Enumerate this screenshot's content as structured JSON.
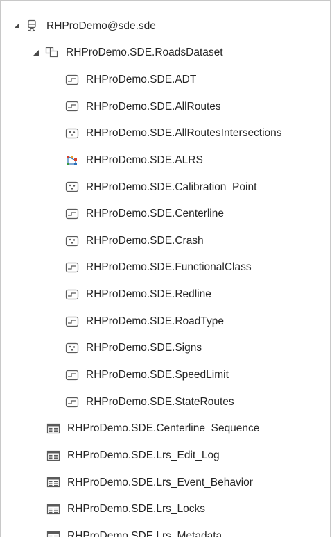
{
  "tree": {
    "root": {
      "label": "RHProDemo@sde.sde",
      "icon": "database-icon",
      "expanded": true
    },
    "dataset": {
      "label": "RHProDemo.SDE.RoadsDataset",
      "icon": "feature-dataset-icon",
      "expanded": true
    },
    "dataset_children": [
      {
        "label": "RHProDemo.SDE.ADT",
        "icon": "line-feature-class-icon"
      },
      {
        "label": "RHProDemo.SDE.AllRoutes",
        "icon": "line-feature-class-icon"
      },
      {
        "label": "RHProDemo.SDE.AllRoutesIntersections",
        "icon": "point-feature-class-icon"
      },
      {
        "label": "RHProDemo.SDE.ALRS",
        "icon": "lrs-network-icon"
      },
      {
        "label": "RHProDemo.SDE.Calibration_Point",
        "icon": "point-feature-class-icon"
      },
      {
        "label": "RHProDemo.SDE.Centerline",
        "icon": "line-feature-class-icon"
      },
      {
        "label": "RHProDemo.SDE.Crash",
        "icon": "point-feature-class-icon"
      },
      {
        "label": "RHProDemo.SDE.FunctionalClass",
        "icon": "line-feature-class-icon"
      },
      {
        "label": "RHProDemo.SDE.Redline",
        "icon": "line-feature-class-icon"
      },
      {
        "label": "RHProDemo.SDE.RoadType",
        "icon": "line-feature-class-icon"
      },
      {
        "label": "RHProDemo.SDE.Signs",
        "icon": "point-feature-class-icon"
      },
      {
        "label": "RHProDemo.SDE.SpeedLimit",
        "icon": "line-feature-class-icon"
      },
      {
        "label": "RHProDemo.SDE.StateRoutes",
        "icon": "line-feature-class-icon"
      }
    ],
    "tables": [
      {
        "label": "RHProDemo.SDE.Centerline_Sequence",
        "icon": "table-icon"
      },
      {
        "label": "RHProDemo.SDE.Lrs_Edit_Log",
        "icon": "table-icon"
      },
      {
        "label": "RHProDemo.SDE.Lrs_Event_Behavior",
        "icon": "table-icon"
      },
      {
        "label": "RHProDemo.SDE.Lrs_Locks",
        "icon": "table-icon"
      },
      {
        "label": "RHProDemo.SDE.Lrs_Metadata",
        "icon": "table-icon"
      }
    ]
  },
  "colors": {
    "text": "#262626",
    "icon_stroke": "#5a5a5a",
    "lrs_red": "#d9412a",
    "lrs_green": "#3a9a3a",
    "lrs_blue": "#2a6fb8",
    "lrs_orange": "#e8a030"
  }
}
